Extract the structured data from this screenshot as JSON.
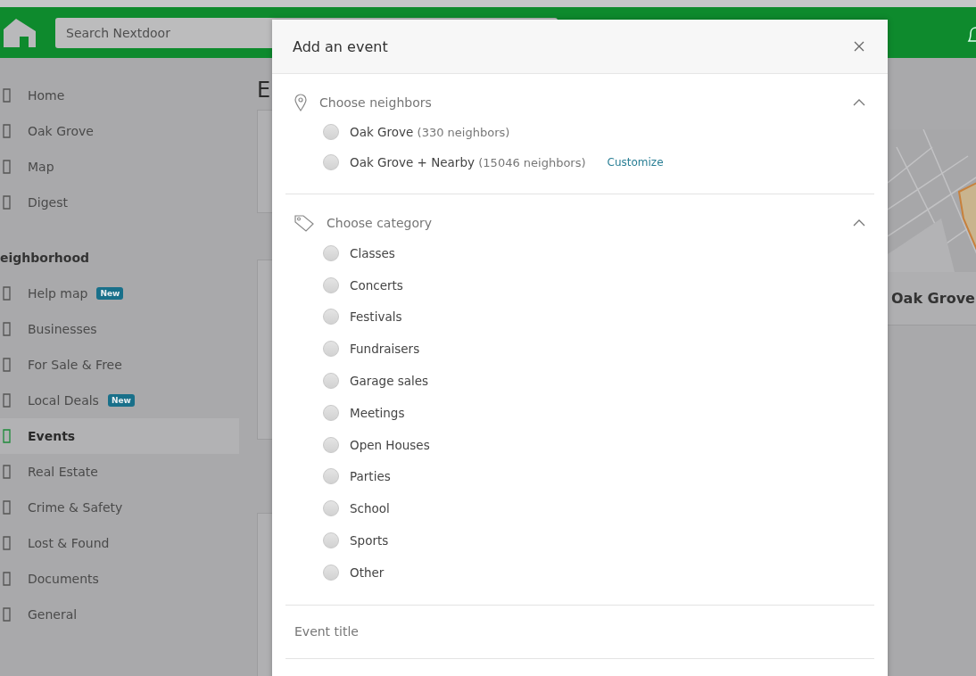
{
  "header": {
    "search": {
      "placeholder": "Search Nextdoor"
    }
  },
  "sidebar": {
    "items": [
      {
        "label": "Home",
        "selected": false
      },
      {
        "label": "Oak Grove",
        "selected": false
      },
      {
        "label": "Map",
        "selected": false
      },
      {
        "label": "Digest",
        "selected": false
      }
    ],
    "section_title": "eighborhood",
    "section_items": [
      {
        "label": "Help map",
        "badge": "New",
        "selected": false
      },
      {
        "label": "Businesses",
        "selected": false
      },
      {
        "label": "For Sale & Free",
        "selected": false
      },
      {
        "label": "Local Deals",
        "badge": "New",
        "selected": false
      },
      {
        "label": "Events",
        "selected": true
      },
      {
        "label": "Real Estate",
        "selected": false
      },
      {
        "label": "Crime & Safety",
        "selected": false
      },
      {
        "label": "Lost & Found",
        "selected": false
      },
      {
        "label": "Documents",
        "selected": false
      },
      {
        "label": "General",
        "selected": false
      }
    ]
  },
  "main": {
    "title": "E"
  },
  "map_card": {
    "title": "Oak Grove"
  },
  "modal": {
    "title": "Add an event",
    "sections": [
      {
        "label": "Choose neighbors",
        "expanded": true,
        "options": [
          {
            "label": "Oak Grove",
            "note": "(330 neighbors)",
            "selected": false
          },
          {
            "label": "Oak Grove + Nearby",
            "note": "(15046 neighbors)",
            "link": "Customize",
            "selected": false
          }
        ]
      },
      {
        "label": "Choose category",
        "expanded": true,
        "options": [
          {
            "label": "Classes",
            "selected": false
          },
          {
            "label": "Concerts",
            "selected": false
          },
          {
            "label": "Festivals",
            "selected": false
          },
          {
            "label": "Fundraisers",
            "selected": false
          },
          {
            "label": "Garage sales",
            "selected": false
          },
          {
            "label": "Meetings",
            "selected": false
          },
          {
            "label": "Open Houses",
            "selected": false
          },
          {
            "label": "Parties",
            "selected": false
          },
          {
            "label": "School",
            "selected": false
          },
          {
            "label": "Sports",
            "selected": false
          },
          {
            "label": "Other",
            "selected": false
          }
        ]
      }
    ],
    "event_title": {
      "placeholder": "Event title"
    }
  }
}
